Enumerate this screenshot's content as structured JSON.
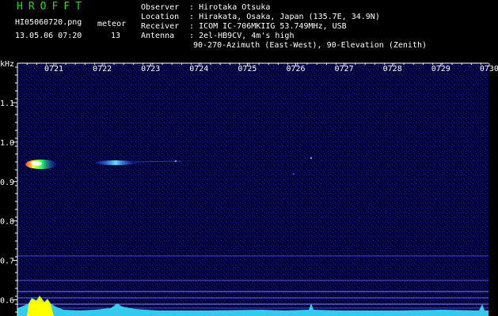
{
  "header": {
    "title": "HROFFT",
    "filename": "HI05060720.png",
    "datetime": "13.05.06 07:20",
    "meteor_label": "meteor",
    "meteor_count": "13"
  },
  "meta": {
    "observer_key": "Observer",
    "observer": "Hirotaka Otsuka",
    "location_key": "Location",
    "location": "Hirakata, Osaka, Japan (135.7E, 34.9N)",
    "receiver_key": "Receiver",
    "receiver": "ICOM IC-706MKIIG 53.749MHz, USB",
    "antenna_key": "Antenna",
    "antenna": "2el-HB9CV, 4m's high",
    "antenna_line2": "90-270-Azimuth (East-West), 90-Elevation (Zenith)"
  },
  "plot": {
    "y_unit": "kHz",
    "x_ticks": [
      "0721",
      "0722",
      "0723",
      "0724",
      "0725",
      "0726",
      "0727",
      "0728",
      "0729",
      "0730"
    ],
    "y_ticks": [
      "1.1",
      "1.0",
      "0.9",
      "0.8",
      "0.7",
      "0.6"
    ],
    "colors": {
      "background": "#00003a",
      "axis": "#ffffff",
      "trace": "#3ae0ff",
      "hot": "#ffff00"
    }
  }
}
